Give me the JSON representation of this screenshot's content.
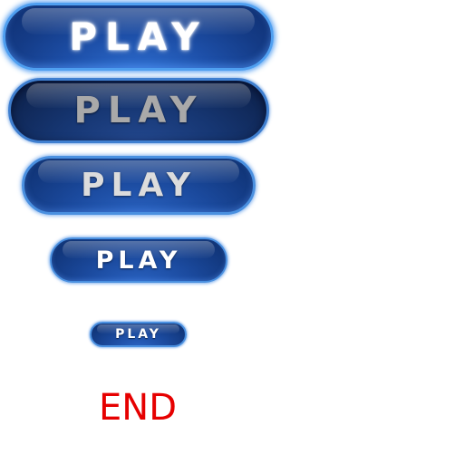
{
  "buttons": [
    {
      "label": "PLAY",
      "state": "hover"
    },
    {
      "label": "PLAY",
      "state": "pressed"
    },
    {
      "label": "PLAY",
      "state": "normal"
    },
    {
      "label": "PLAY",
      "state": "normal"
    },
    {
      "label": "PLAY",
      "state": "normal"
    }
  ],
  "end_label": "END",
  "colors": {
    "button_base": "#1b4a9e",
    "button_border": "#4a90e0",
    "glow": "#4f9ff0",
    "label_white": "#ffffff",
    "label_gray": "#a9a9a9",
    "end_text": "#e60000",
    "background": "#ffffff"
  }
}
